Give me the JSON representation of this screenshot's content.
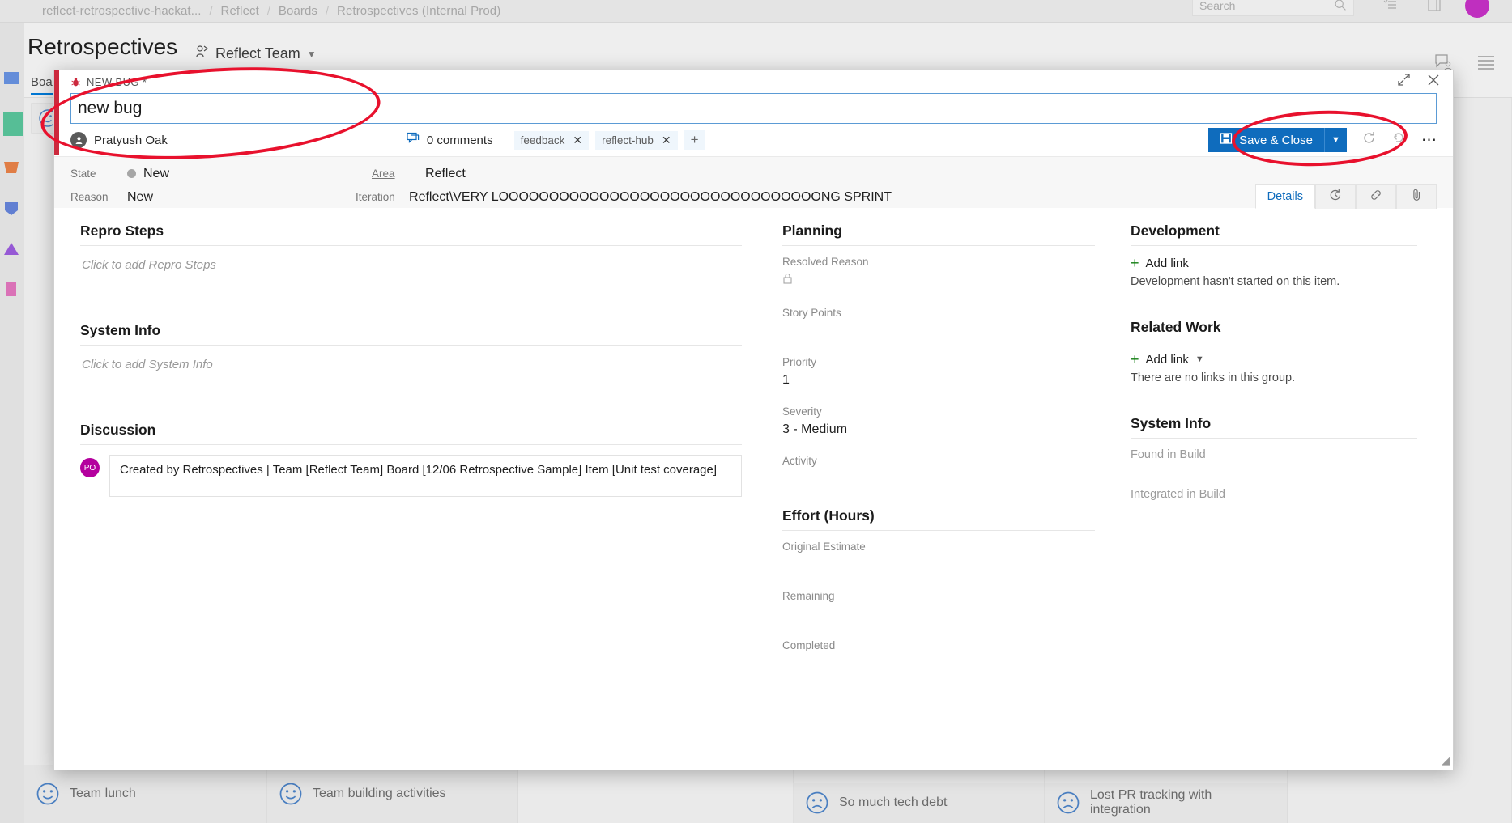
{
  "app": {
    "breadcrumb": [
      "reflect-retrospective-hackat...",
      "Reflect",
      "Boards",
      "Retrospectives (Internal Prod)"
    ],
    "breadcrumb_separator": "/",
    "search_placeholder": "Search",
    "page_title": "Retrospectives",
    "team_name": "Reflect Team",
    "board_tab": "Board",
    "background_cards": [
      {
        "text": "Team lunch",
        "mood": "happy"
      },
      {
        "text": "Team building activities",
        "mood": "happy"
      },
      {
        "text": "So much tech debt",
        "mood": "sad"
      },
      {
        "text": "Lost PR tracking with integration",
        "mood": "sad"
      }
    ]
  },
  "dialog": {
    "title_label": "NEW BUG *",
    "work_item_title": "new bug",
    "expand_icon": "expand-icon",
    "close_icon": "close-icon",
    "assignee": "Pratyush Oak",
    "assignee_initials": "",
    "comments_label": "0 comments",
    "tags": [
      "feedback",
      "reflect-hub"
    ],
    "tag_add_label": "+",
    "save_label": "Save & Close",
    "save_caret": "▼",
    "refresh_icon": "refresh-icon",
    "revert_icon": "undo-icon",
    "more_icon": "more-actions-icon",
    "fields": {
      "state_label": "State",
      "state_value": "New",
      "reason_label": "Reason",
      "reason_value": "New",
      "area_label": "Area",
      "area_value": "Reflect",
      "iteration_label": "Iteration",
      "iteration_value": "Reflect\\VERY LOOOOOOOOOOOOOOOOOOOOOOOOOOOOOOOONG SPRINT"
    },
    "tabs": [
      {
        "label": "Details",
        "name": "tab-details",
        "active": true
      },
      {
        "label": "↺",
        "name": "tab-history",
        "active": false
      },
      {
        "label": "⚭",
        "name": "tab-links",
        "active": false
      },
      {
        "label": "⎇",
        "name": "tab-attachments",
        "active": false
      }
    ],
    "left_column": {
      "repro_steps_heading": "Repro Steps",
      "repro_steps_placeholder": "Click to add Repro Steps",
      "system_info_heading": "System Info",
      "system_info_placeholder": "Click to add System Info",
      "discussion_heading": "Discussion",
      "discussion_avatar_initials": "PO",
      "discussion_text": "Created by Retrospectives | Team [Reflect Team] Board [12/06 Retrospective Sample] Item [Unit test coverage]"
    },
    "middle_column": {
      "planning_heading": "Planning",
      "resolved_reason_label": "Resolved Reason",
      "resolved_reason_value": "",
      "story_points_label": "Story Points",
      "story_points_value": "",
      "priority_label": "Priority",
      "priority_value": "1",
      "severity_label": "Severity",
      "severity_value": "3 - Medium",
      "activity_label": "Activity",
      "activity_value": "",
      "effort_heading": "Effort (Hours)",
      "original_estimate_label": "Original Estimate",
      "original_estimate_value": "",
      "remaining_label": "Remaining",
      "remaining_value": "",
      "completed_label": "Completed",
      "completed_value": ""
    },
    "right_column": {
      "development_heading": "Development",
      "development_add_link": "Add link",
      "development_empty": "Development hasn't started on this item.",
      "related_work_heading": "Related Work",
      "related_work_add_link": "Add link",
      "related_work_empty": "There are no links in this group.",
      "system_info_heading": "System Info",
      "found_in_build_label": "Found in Build",
      "integrated_in_build_label": "Integrated in Build"
    }
  },
  "colors": {
    "accent_blue": "#0f6cbd",
    "bug_red": "#cc293d",
    "annotation_red": "#e8112d",
    "add_green": "#107c10",
    "avatar_magenta": "#b4009e"
  }
}
